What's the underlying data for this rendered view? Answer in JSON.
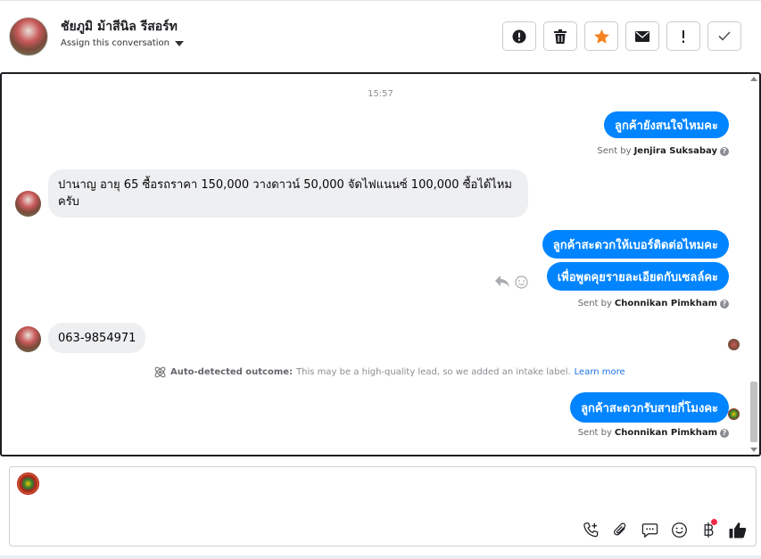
{
  "header": {
    "name": "ชัยภูมิ ม้าสีนิล รีสอร์ท",
    "assign_label": "Assign this conversation",
    "actions": [
      {
        "name": "report-button",
        "icon": "exclamation-circle-icon"
      },
      {
        "name": "delete-button",
        "icon": "trash-icon"
      },
      {
        "name": "star-button",
        "icon": "star-icon"
      },
      {
        "name": "mark-unread-button",
        "icon": "envelope-icon"
      },
      {
        "name": "follow-up-button",
        "icon": "exclamation-icon"
      },
      {
        "name": "mark-done-button",
        "icon": "check-icon"
      }
    ]
  },
  "conversation": {
    "timestamp": "15:57",
    "messages": [
      {
        "dir": "out",
        "text": "ลูกค้ายังสนใจไหมคะ"
      },
      {
        "dir": "in",
        "text": "ปานาญ อายุ 65 ซื้อรถราคา 150,000 วางดาวน์ 50,000 จัดไฟแนนซ์ 100,000 ซื้อได้ไหมครับ"
      },
      {
        "dir": "out",
        "text": "ลูกค้าสะดวกให้เบอร์ติดต่อไหมคะ"
      },
      {
        "dir": "out",
        "text": "เพื่อพูดคุยรายละเอียดกับเซลล์คะ"
      },
      {
        "dir": "in",
        "text": "063-9854971"
      },
      {
        "dir": "out",
        "text": "ลูกค้าสะดวกรับสายกี่โมงคะ"
      }
    ],
    "sent_by": [
      {
        "prefix": "Sent by",
        "name": "Jenjira Suksabay"
      },
      {
        "prefix": "Sent by",
        "name": "Chonnikan Pimkham"
      },
      {
        "prefix": "Sent by",
        "name": "Chonnikan Pimkham"
      }
    ],
    "auto_detected": {
      "label": "Auto-detected outcome:",
      "text": "This may be a high-quality lead, so we added an intake label.",
      "link": "Learn more"
    }
  },
  "composer": {
    "tools": [
      "phone-add-icon",
      "paperclip-icon",
      "saved-reply-icon",
      "emoji-icon",
      "baht-payment-icon",
      "thumbs-up-icon"
    ]
  },
  "colors": {
    "accent": "#0084ff",
    "star": "#f5821f",
    "incoming_bubble": "#eeeff1",
    "notification_dot": "#f02849"
  }
}
